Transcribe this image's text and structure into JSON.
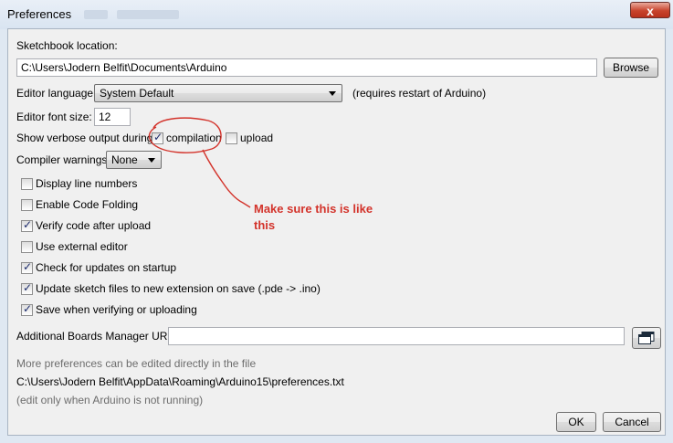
{
  "window": {
    "title": "Preferences",
    "close_glyph": "x"
  },
  "sketchbook": {
    "label": "Sketchbook location:",
    "value": "C:\\Users\\Jodern Belfit\\Documents\\Arduino",
    "browse_label": "Browse"
  },
  "editor_language": {
    "label": "Editor language:",
    "selected": "System Default",
    "note": "(requires restart of Arduino)"
  },
  "font_size": {
    "label": "Editor font size:",
    "value": "12"
  },
  "verbose": {
    "label": "Show verbose output during:",
    "compilation_label": "compilation",
    "compilation_checked": true,
    "upload_label": "upload",
    "upload_checked": false
  },
  "warnings": {
    "label": "Compiler warnings:",
    "selected": "None"
  },
  "options": [
    {
      "label": "Display line numbers",
      "checked": false
    },
    {
      "label": "Enable Code Folding",
      "checked": false
    },
    {
      "label": "Verify code after upload",
      "checked": true
    },
    {
      "label": "Use external editor",
      "checked": false
    },
    {
      "label": "Check for updates on startup",
      "checked": true
    },
    {
      "label": "Update sketch files to new extension on save (.pde -> .ino)",
      "checked": true
    },
    {
      "label": "Save when verifying or uploading",
      "checked": true
    }
  ],
  "boards_manager": {
    "label": "Additional Boards Manager URLs:",
    "value": "",
    "open_icon": "window-list-icon"
  },
  "footer": {
    "more_prefs": "More preferences can be edited directly in the file",
    "path": "C:\\Users\\Jodern Belfit\\AppData\\Roaming\\Arduino15\\preferences.txt",
    "edit_note": "(edit only when Arduino is not running)"
  },
  "buttons": {
    "ok": "OK",
    "cancel": "Cancel"
  },
  "annotation": {
    "text_line1": "Make sure this is like",
    "text_line2": "this",
    "color": "#d3332b"
  }
}
